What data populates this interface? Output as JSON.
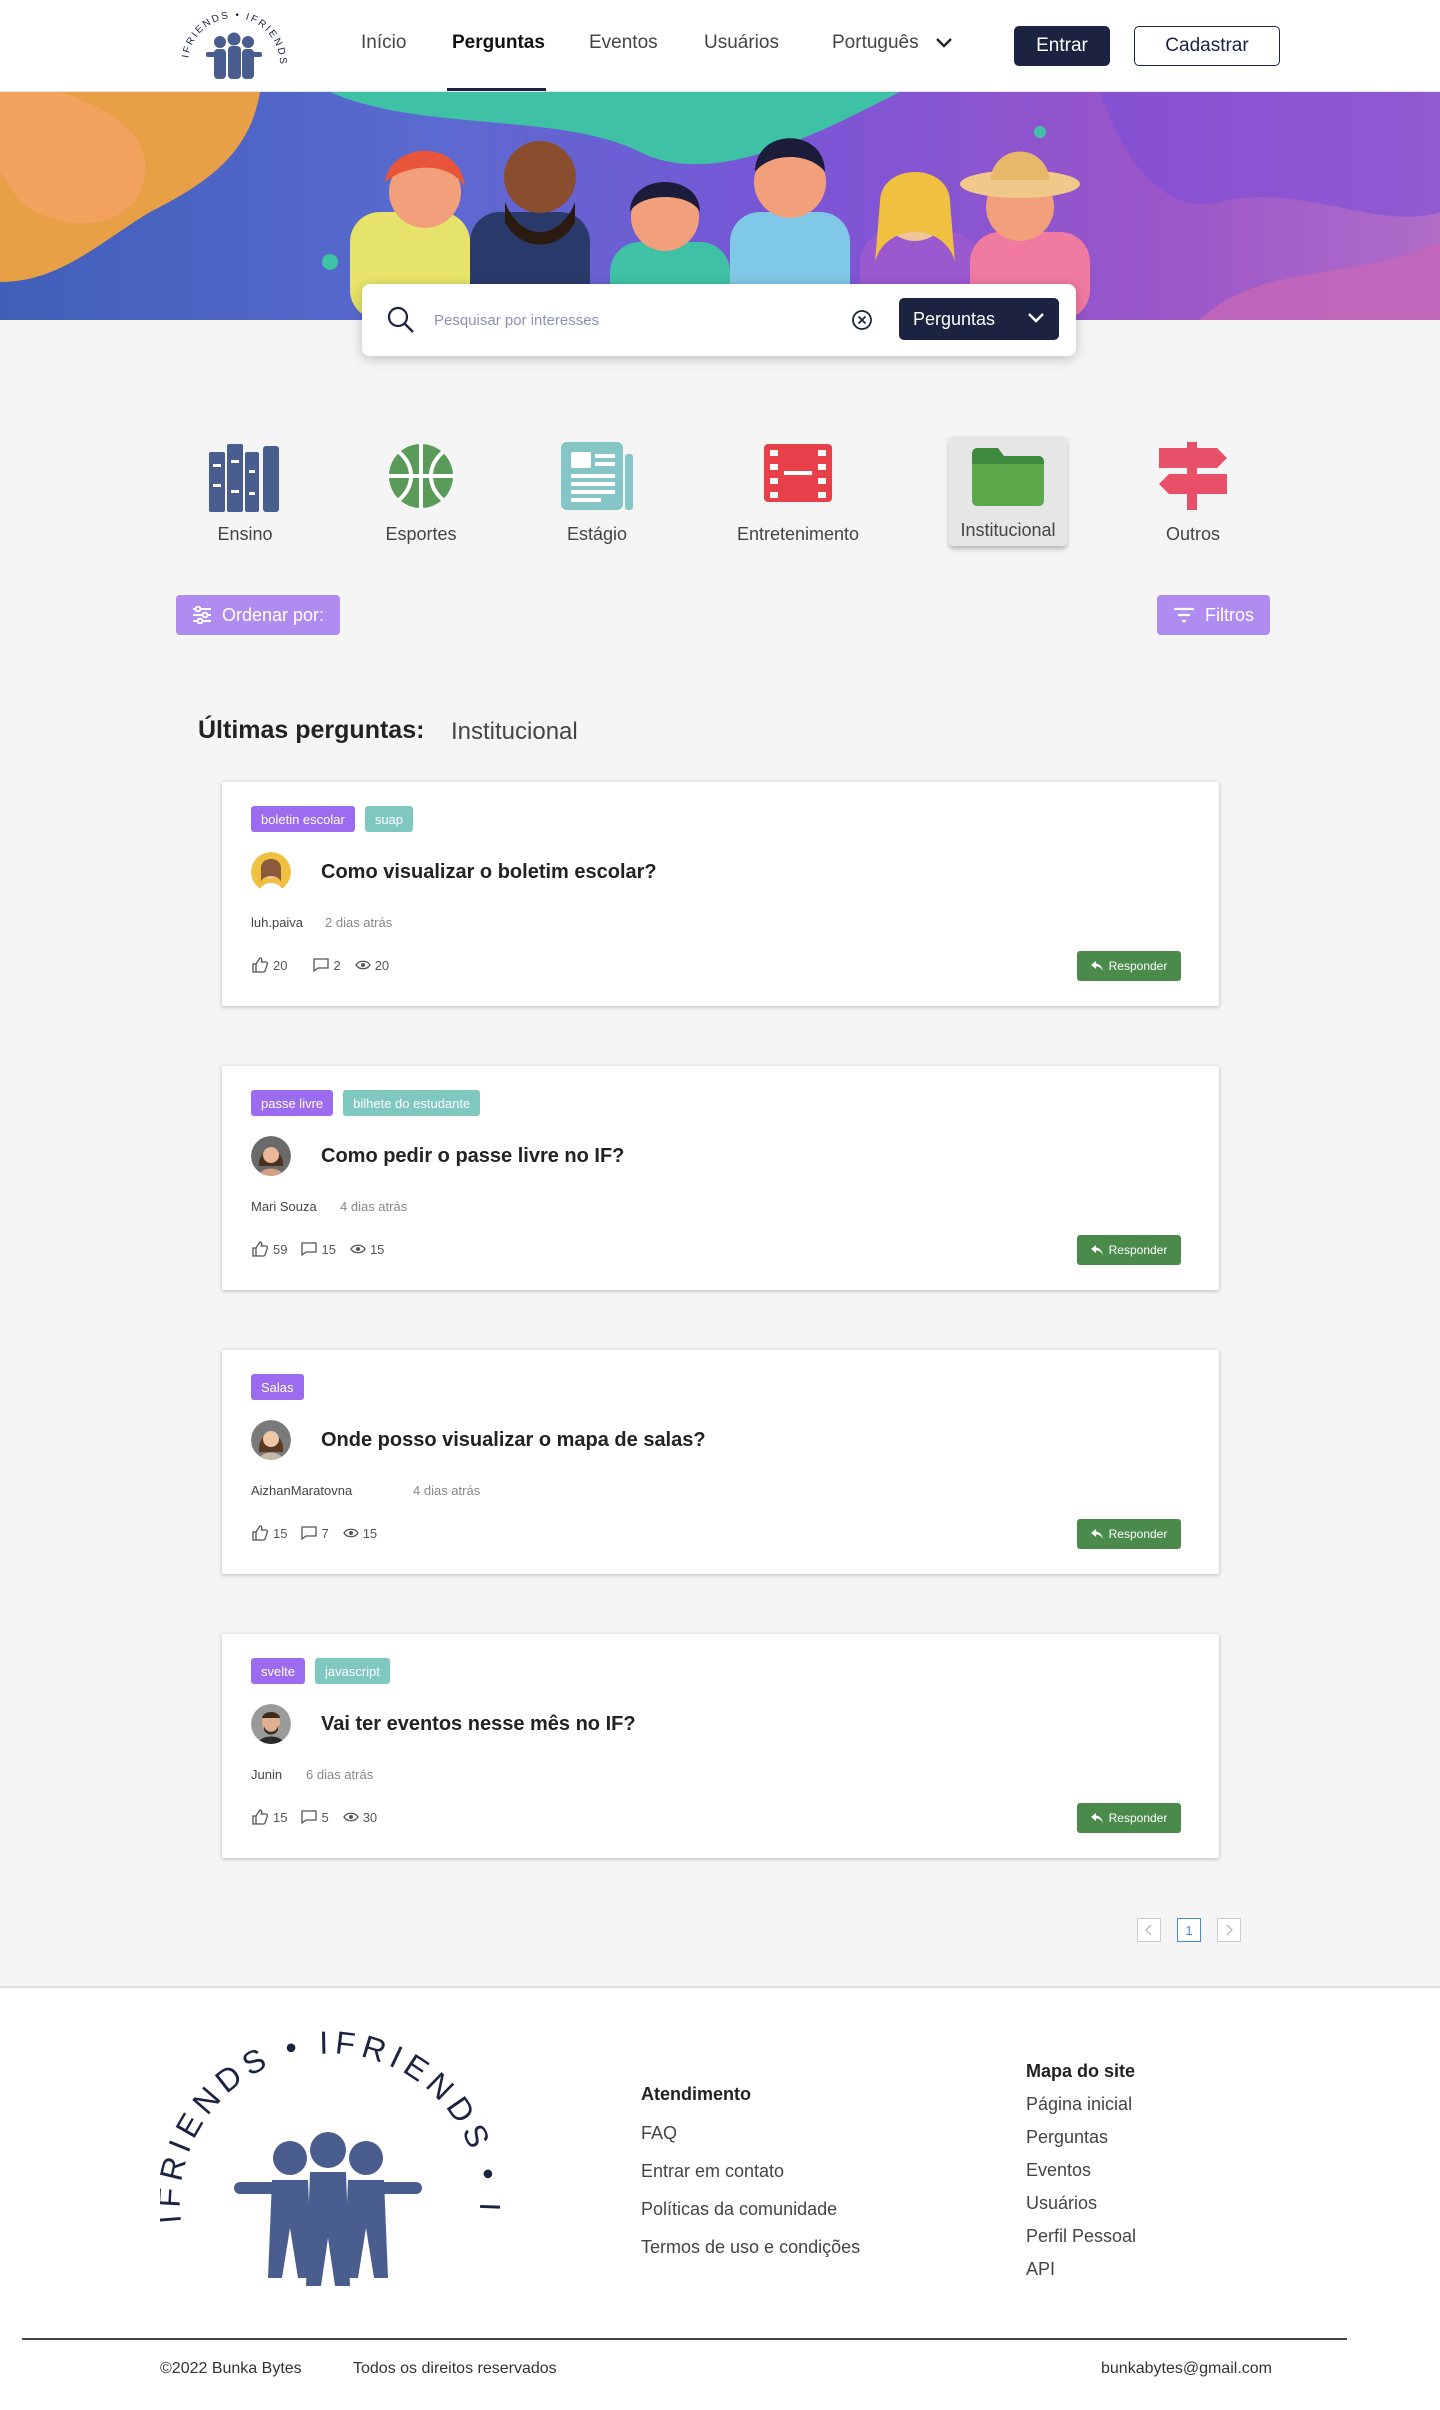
{
  "nav": {
    "logo_text": "IFRIENDS",
    "links": [
      "Início",
      "Perguntas",
      "Eventos",
      "Usuários"
    ],
    "language": "Português",
    "login": "Entrar",
    "signup": "Cadastrar"
  },
  "search": {
    "placeholder": "Pesquisar por interesses",
    "select_value": "Perguntas"
  },
  "categories": [
    "Ensino",
    "Esportes",
    "Estágio",
    "Entretenimento",
    "Institucional",
    "Outros"
  ],
  "active_category": "Institucional",
  "controls": {
    "sort": "Ordenar por:",
    "filter": "Filtros"
  },
  "list": {
    "title": "Últimas perguntas:",
    "category": "Institucional",
    "reply_label": "Responder",
    "questions": [
      {
        "tags": [
          "boletin escolar",
          "suap"
        ],
        "title": "Como visualizar o boletim escolar?",
        "author": "luh.paiva",
        "time": "2 dias atrás",
        "likes": "20",
        "comments": "2",
        "views": "20"
      },
      {
        "tags": [
          "passe livre",
          "bilhete do estudante"
        ],
        "title": "Como pedir o passe livre no IF?",
        "author": "Mari Souza",
        "time": "4 dias atrás",
        "likes": "59",
        "comments": "15",
        "views": "15"
      },
      {
        "tags": [
          "Salas"
        ],
        "title": "Onde posso visualizar o mapa de salas?",
        "author": "AizhanMaratovna",
        "time": "4 dias atrás",
        "likes": "15",
        "comments": "7",
        "views": "15"
      },
      {
        "tags": [
          "svelte",
          "javascript"
        ],
        "title": "Vai ter eventos nesse mês no IF?",
        "author": "Junin",
        "time": "6 dias atrás",
        "likes": "15",
        "comments": "5",
        "views": "30"
      }
    ]
  },
  "pagination": {
    "current": "1"
  },
  "footer": {
    "logo_text": "IFRIENDS",
    "atendimento": {
      "title": "Atendimento",
      "links": [
        "FAQ",
        "Entrar em contato",
        "Políticas da comunidade",
        "Termos de uso e condições"
      ]
    },
    "mapa": {
      "title": "Mapa do site",
      "links": [
        "Página inicial",
        "Perguntas",
        "Eventos",
        "Usuários",
        "Perfil Pessoal",
        "API"
      ]
    },
    "copyright": "©2022 Bunka Bytes",
    "rights": "Todos os direitos reservados",
    "email": "bunkabytes@gmail.com"
  },
  "colors": {
    "navy": "#1b2340",
    "purple": "#9b6bf0",
    "teal": "#7fc8c0",
    "green": "#4a8a4a"
  }
}
